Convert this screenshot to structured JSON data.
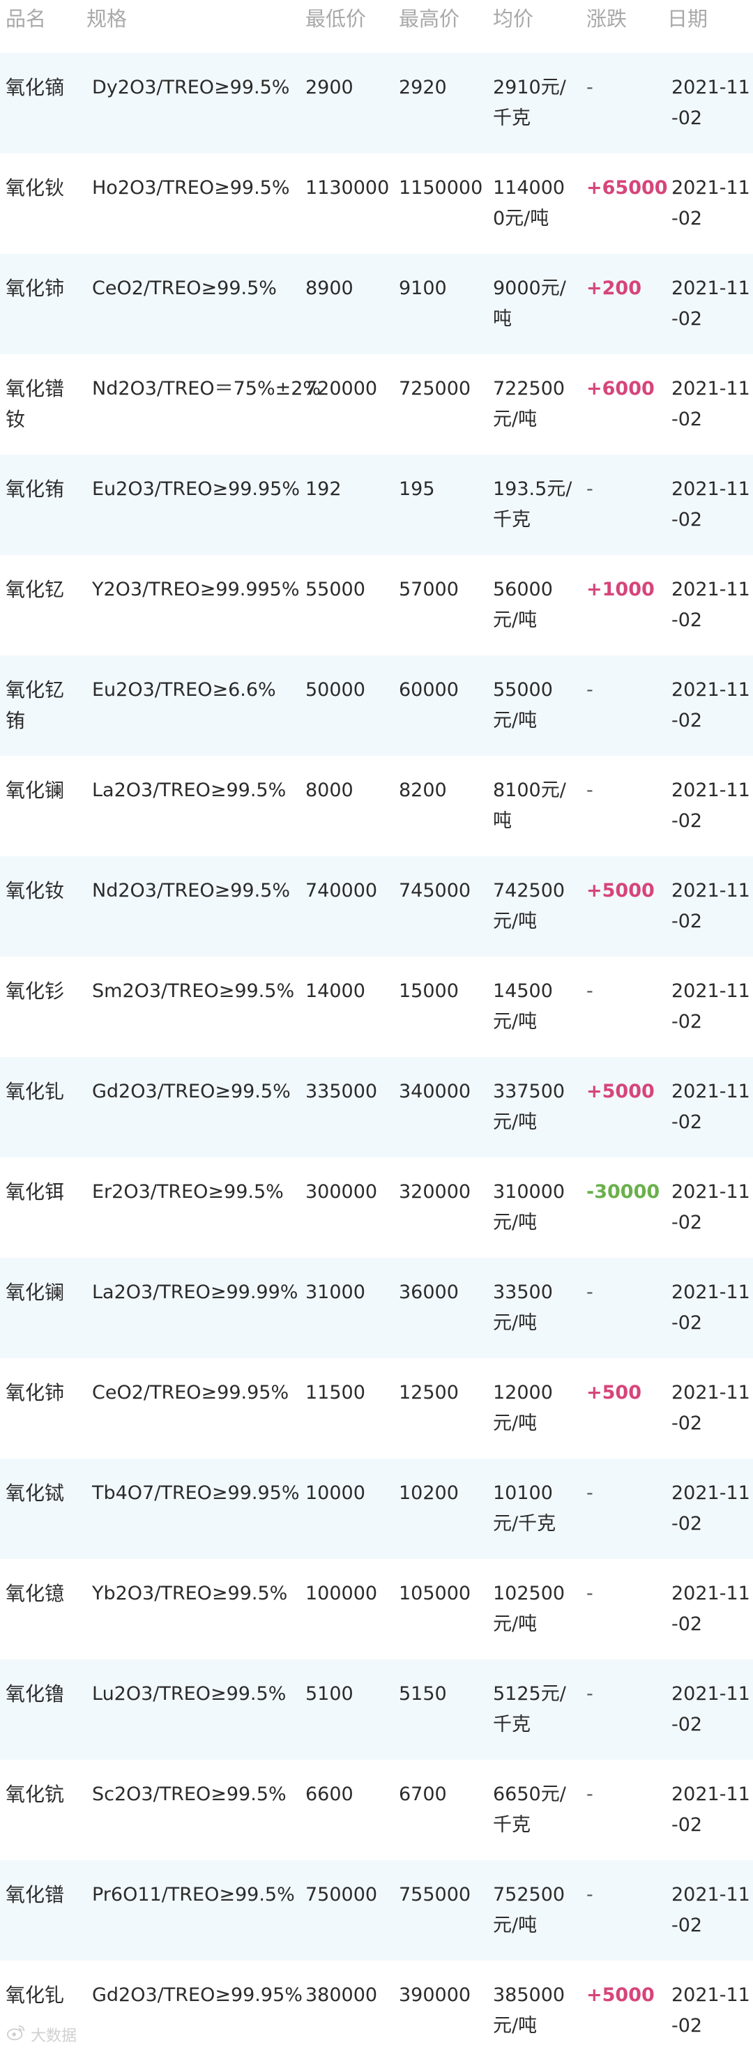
{
  "headers": [
    "品名",
    "规格",
    "最低价",
    "最高价",
    "均价",
    "涨跌",
    "日期"
  ],
  "rows": [
    {
      "name": "氧化镝",
      "spec": "Dy2O3/TREO≥99.5%",
      "low": "2900",
      "high": "2920",
      "avg": "2910元/千克",
      "change": "-",
      "trend": "flat",
      "date": "2021-11-02"
    },
    {
      "name": "氧化钬",
      "spec": "Ho2O3/TREO≥99.5%",
      "low": "1130000",
      "high": "1150000",
      "avg": "1140000元/吨",
      "change": "+65000",
      "trend": "up",
      "date": "2021-11-02"
    },
    {
      "name": "氧化铈",
      "spec": "CeO2/TREO≥99.5%",
      "low": "8900",
      "high": "9100",
      "avg": "9000元/吨",
      "change": "+200",
      "trend": "up",
      "date": "2021-11-02"
    },
    {
      "name": "氧化镨钕",
      "spec": "Nd2O3/TREO＝75%±2%",
      "low": "720000",
      "high": "725000",
      "avg": "722500元/吨",
      "change": "+6000",
      "trend": "up",
      "date": "2021-11-02"
    },
    {
      "name": "氧化铕",
      "spec": "Eu2O3/TREO≥99.95%",
      "low": "192",
      "high": "195",
      "avg": "193.5元/千克",
      "change": "-",
      "trend": "flat",
      "date": "2021-11-02"
    },
    {
      "name": "氧化钇",
      "spec": "Y2O3/TREO≥99.995%",
      "low": "55000",
      "high": "57000",
      "avg": "56000元/吨",
      "change": "+1000",
      "trend": "up",
      "date": "2021-11-02"
    },
    {
      "name": "氧化钇铕",
      "spec": "Eu2O3/TREO≥6.6%",
      "low": "50000",
      "high": "60000",
      "avg": "55000元/吨",
      "change": "-",
      "trend": "flat",
      "date": "2021-11-02"
    },
    {
      "name": "氧化镧",
      "spec": "La2O3/TREO≥99.5%",
      "low": "8000",
      "high": "8200",
      "avg": "8100元/吨",
      "change": "-",
      "trend": "flat",
      "date": "2021-11-02"
    },
    {
      "name": "氧化钕",
      "spec": "Nd2O3/TREO≥99.5%",
      "low": "740000",
      "high": "745000",
      "avg": "742500元/吨",
      "change": "+5000",
      "trend": "up",
      "date": "2021-11-02"
    },
    {
      "name": "氧化钐",
      "spec": "Sm2O3/TREO≥99.5%",
      "low": "14000",
      "high": "15000",
      "avg": "14500元/吨",
      "change": "-",
      "trend": "flat",
      "date": "2021-11-02"
    },
    {
      "name": "氧化钆",
      "spec": "Gd2O3/TREO≥99.5%",
      "low": "335000",
      "high": "340000",
      "avg": "337500元/吨",
      "change": "+5000",
      "trend": "up",
      "date": "2021-11-02"
    },
    {
      "name": "氧化铒",
      "spec": "Er2O3/TREO≥99.5%",
      "low": "300000",
      "high": "320000",
      "avg": "310000元/吨",
      "change": "-30000",
      "trend": "down",
      "date": "2021-11-02"
    },
    {
      "name": "氧化镧",
      "spec": "La2O3/TREO≥99.99%",
      "low": "31000",
      "high": "36000",
      "avg": "33500元/吨",
      "change": "-",
      "trend": "flat",
      "date": "2021-11-02"
    },
    {
      "name": "氧化铈",
      "spec": "CeO2/TREO≥99.95%",
      "low": "11500",
      "high": "12500",
      "avg": "12000元/吨",
      "change": "+500",
      "trend": "up",
      "date": "2021-11-02"
    },
    {
      "name": "氧化铽",
      "spec": "Tb4O7/TREO≥99.95%",
      "low": "10000",
      "high": "10200",
      "avg": "10100元/千克",
      "change": "-",
      "trend": "flat",
      "date": "2021-11-02"
    },
    {
      "name": "氧化镱",
      "spec": "Yb2O3/TREO≥99.5%",
      "low": "100000",
      "high": "105000",
      "avg": "102500元/吨",
      "change": "-",
      "trend": "flat",
      "date": "2021-11-02"
    },
    {
      "name": "氧化镥",
      "spec": "Lu2O3/TREO≥99.5%",
      "low": "5100",
      "high": "5150",
      "avg": "5125元/千克",
      "change": "-",
      "trend": "flat",
      "date": "2021-11-02"
    },
    {
      "name": "氧化钪",
      "spec": "Sc2O3/TREO≥99.5%",
      "low": "6600",
      "high": "6700",
      "avg": "6650元/千克",
      "change": "-",
      "trend": "flat",
      "date": "2021-11-02"
    },
    {
      "name": "氧化镨",
      "spec": "Pr6O11/TREO≥99.5%",
      "low": "750000",
      "high": "755000",
      "avg": "752500元/吨",
      "change": "-",
      "trend": "flat",
      "date": "2021-11-02"
    },
    {
      "name": "氧化钆",
      "spec": "Gd2O3/TREO≥99.95%",
      "low": "380000",
      "high": "390000",
      "avg": "385000元/吨",
      "change": "+5000",
      "trend": "up",
      "date": "2021-11-02"
    }
  ],
  "watermark": {
    "text": "大数据",
    "icon": "weibo-icon"
  },
  "colors": {
    "up": "#d6457a",
    "down": "#6ab04c",
    "stripe": "#f2f9fd"
  }
}
